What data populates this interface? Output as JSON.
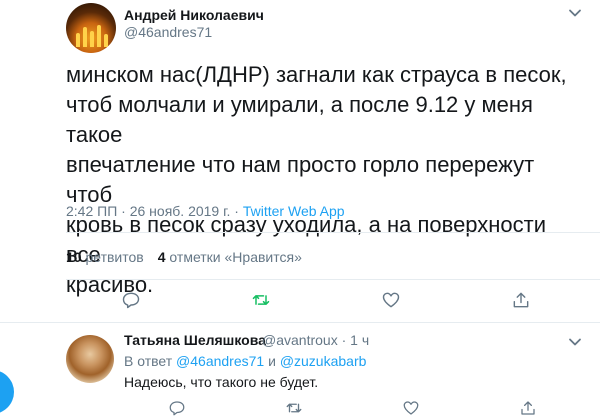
{
  "tweet": {
    "author_name": "Андрей Николаевич",
    "author_handle": "@46andres71",
    "text": "минском нас(ЛДНР) загнали как страуса в песок,\nчтоб молчали и умирали, а после 9.12 у меня такое\nвпечатление что нам просто горло перережут чтоб\nкровь в песок сразу уходила, а на поверхности все\nкрасиво.",
    "time": "2:42 ПП",
    "date": "26 нояб. 2019 г.",
    "sep": "·",
    "source": "Twitter Web App",
    "retweets_count": "10",
    "retweets_label": "ретвитов",
    "likes_count": "4",
    "likes_label": "отметки «Нравится»"
  },
  "reply": {
    "author_name": "Татьяна Шеляшкова",
    "author_handle": "@avantroux",
    "sep": "·",
    "time": "1 ч",
    "in_reply_prefix": "В ответ",
    "in_reply_user1": "@46andres71",
    "in_reply_and": "и",
    "in_reply_user2": "@zuzukabarb",
    "text": "Надеюсь, что такого не будет."
  },
  "colors": {
    "accent": "#1da1f2",
    "retweet_green": "#17bf63",
    "secondary_text": "#657786"
  },
  "icons": [
    "chevron-down-icon",
    "reply-icon",
    "retweet-icon",
    "like-icon",
    "share-icon"
  ]
}
